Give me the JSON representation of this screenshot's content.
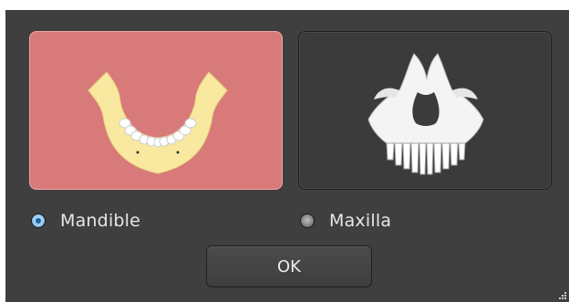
{
  "dialog": {
    "options": [
      {
        "label": "Mandible",
        "selected": true,
        "icon": "mandible-jaw-icon"
      },
      {
        "label": "Maxilla",
        "selected": false,
        "icon": "maxilla-skull-icon"
      }
    ],
    "ok_label": "OK"
  },
  "colors": {
    "dialog_bg": "#3f3f3f",
    "selected_card": "#d8797a",
    "unselected_card": "#3b3b3b",
    "radio_selected": "#1b63a3",
    "text": "#e7e7e7"
  }
}
